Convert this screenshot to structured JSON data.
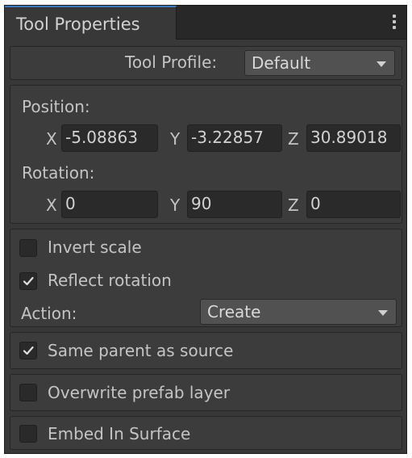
{
  "window": {
    "tab_title": "Tool Properties",
    "menu_icon": "kebab-menu-icon"
  },
  "profile": {
    "label": "Tool Profile:",
    "value": "Default"
  },
  "transform": {
    "position_label": "Position:",
    "rotation_label": "Rotation:",
    "position": [
      {
        "axis": "X",
        "value": "-5.08863"
      },
      {
        "axis": "Y",
        "value": "-3.22857"
      },
      {
        "axis": "Z",
        "value": "30.89018"
      }
    ],
    "rotation": [
      {
        "axis": "X",
        "value": "0"
      },
      {
        "axis": "Y",
        "value": "90"
      },
      {
        "axis": "Z",
        "value": "0"
      }
    ]
  },
  "options": {
    "invert_scale": {
      "label": "Invert scale",
      "checked": false
    },
    "reflect_rotation": {
      "label": "Reflect rotation",
      "checked": true
    },
    "action_label": "Action:",
    "action_value": "Create"
  },
  "same_parent": {
    "label": "Same parent as source",
    "checked": true
  },
  "overwrite_layer": {
    "label": "Overwrite prefab layer",
    "checked": false
  },
  "embed_surface": {
    "label": "Embed In Surface",
    "checked": false
  },
  "colors": {
    "panel": "#383838",
    "tab_accent": "#3a79bb",
    "field": "#2a2a2a",
    "dropdown": "#515151"
  }
}
